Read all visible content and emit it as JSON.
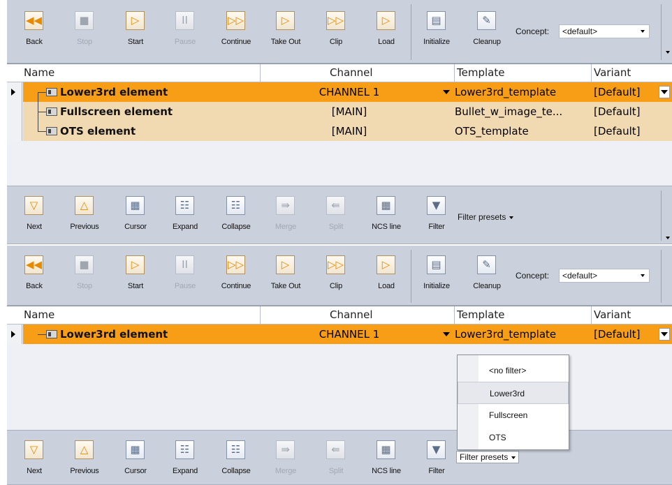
{
  "toolbar_top": {
    "buttons": [
      {
        "label": "Back",
        "icon": "rewind-icon",
        "glyph": "◀◀",
        "enabled": true
      },
      {
        "label": "Stop",
        "icon": "stop-icon",
        "glyph": "■",
        "enabled": false
      },
      {
        "label": "Start",
        "icon": "play-icon",
        "glyph": "▷",
        "enabled": true
      },
      {
        "label": "Pause",
        "icon": "pause-icon",
        "glyph": "II",
        "enabled": false
      },
      {
        "label": "Continue",
        "icon": "continue-icon",
        "glyph": "▷▷",
        "enabled": true
      },
      {
        "label": "Take Out",
        "icon": "take-out-icon",
        "glyph": "▷",
        "enabled": true
      },
      {
        "label": "Clip",
        "icon": "clip-icon",
        "glyph": "▷▷",
        "enabled": true
      },
      {
        "label": "Load",
        "icon": "load-icon",
        "glyph": "▷",
        "enabled": true
      },
      {
        "label": "Initialize",
        "icon": "initialize-icon",
        "glyph": "▤",
        "enabled": true
      },
      {
        "label": "Cleanup",
        "icon": "cleanup-icon",
        "glyph": "✎",
        "enabled": true
      }
    ],
    "concept_label": "Concept:",
    "concept_value": "<default>"
  },
  "toolbar_bottom": {
    "buttons": [
      {
        "label": "Next",
        "icon": "down-arrow-icon",
        "glyph": "▽",
        "enabled": true
      },
      {
        "label": "Previous",
        "icon": "up-arrow-icon",
        "glyph": "△",
        "enabled": true
      },
      {
        "label": "Cursor",
        "icon": "cursor-icon",
        "glyph": "▦",
        "enabled": true
      },
      {
        "label": "Expand",
        "icon": "expand-icon",
        "glyph": "☷",
        "enabled": true
      },
      {
        "label": "Collapse",
        "icon": "collapse-icon",
        "glyph": "☷",
        "enabled": true
      },
      {
        "label": "Merge",
        "icon": "merge-icon",
        "glyph": "⇛",
        "enabled": false
      },
      {
        "label": "Split",
        "icon": "split-icon",
        "glyph": "⇚",
        "enabled": false
      },
      {
        "label": "NCS line",
        "icon": "ncs-line-icon",
        "glyph": "▦",
        "enabled": true
      },
      {
        "label": "Filter",
        "icon": "filter-icon",
        "glyph": "▼",
        "enabled": true
      }
    ],
    "filter_presets": "Filter presets"
  },
  "columns": {
    "name": "Name",
    "channel": "Channel",
    "template": "Template",
    "variant": "Variant"
  },
  "panel1": {
    "rows": [
      {
        "name": "Lower3rd element",
        "channel": "CHANNEL 1",
        "template": "Lower3rd_template",
        "variant": "[Default]",
        "selected": true
      },
      {
        "name": "Fullscreen element",
        "channel": "[MAIN]",
        "template": "Bullet_w_image_te...",
        "variant": "[Default]",
        "selected": false
      },
      {
        "name": "OTS element",
        "channel": "[MAIN]",
        "template": "OTS_template",
        "variant": "[Default]",
        "selected": false
      }
    ]
  },
  "panel2": {
    "rows": [
      {
        "name": "Lower3rd element",
        "channel": "CHANNEL 1",
        "template": "Lower3rd_template",
        "variant": "[Default]",
        "selected": true
      }
    ],
    "filter_menu": [
      "<no filter>",
      "Lower3rd",
      "Fullscreen",
      "OTS"
    ],
    "filter_menu_highlighted": "Lower3rd"
  },
  "colors": {
    "selected_row": "#f89e16",
    "alt_row": "#f1d9b2",
    "toolbar": "#cbd1dc",
    "accent_icon": "#e88a00"
  }
}
